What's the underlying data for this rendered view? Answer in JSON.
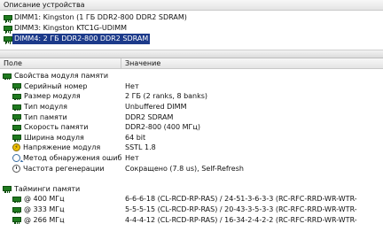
{
  "device_panel": {
    "header": "Описание устройства",
    "items": [
      {
        "label": "DIMM1: Kingston (1 ГБ DDR2-800 DDR2 SDRAM)",
        "selected": false
      },
      {
        "label": "DIMM3: Kingston KTC1G-UDIMM",
        "selected": false
      },
      {
        "label": "DIMM4: 2 ГБ DDR2-800 DDR2 SDRAM",
        "selected": true
      }
    ]
  },
  "props_panel": {
    "col_field": "Поле",
    "col_value": "Значение",
    "group_properties": "Свойства модуля памяти",
    "rows": [
      {
        "field": "Серийный номер",
        "value": "Нет",
        "icon": "memory-module-icon"
      },
      {
        "field": "Размер модуля",
        "value": "2 ГБ (2 ranks, 8 banks)",
        "icon": "memory-module-icon"
      },
      {
        "field": "Тип модуля",
        "value": "Unbuffered DIMM",
        "icon": "memory-module-icon"
      },
      {
        "field": "Тип памяти",
        "value": "DDR2 SDRAM",
        "icon": "memory-module-icon"
      },
      {
        "field": "Скорость памяти",
        "value": "DDR2-800 (400 МГц)",
        "icon": "memory-module-icon"
      },
      {
        "field": "Ширина модуля",
        "value": "64 bit",
        "icon": "memory-module-icon"
      },
      {
        "field": "Напряжение модуля",
        "value": "SSTL 1.8",
        "icon": "voltage-icon"
      },
      {
        "field": "Метод обнаружения ошиб...",
        "value": "Нет",
        "icon": "search-icon"
      },
      {
        "field": "Частота регенерации",
        "value": "Сокращено (7.8 us), Self-Refresh",
        "icon": "clock-icon"
      }
    ],
    "group_timings": "Тайминги памяти",
    "timings": [
      {
        "field": "@ 400 МГц",
        "value": "6-6-6-18  (CL-RCD-RP-RAS) / 24-51-3-6-3-3  (RC-RFC-RRD-WR-WTR-"
      },
      {
        "field": "@ 333 МГц",
        "value": "5-5-5-15  (CL-RCD-RP-RAS) / 20-43-3-5-3-3  (RC-RFC-RRD-WR-WTR-"
      },
      {
        "field": "@ 266 МГц",
        "value": "4-4-4-12  (CL-RCD-RP-RAS) / 16-34-2-4-2-2  (RC-RFC-RRD-WR-WTR-"
      }
    ]
  }
}
